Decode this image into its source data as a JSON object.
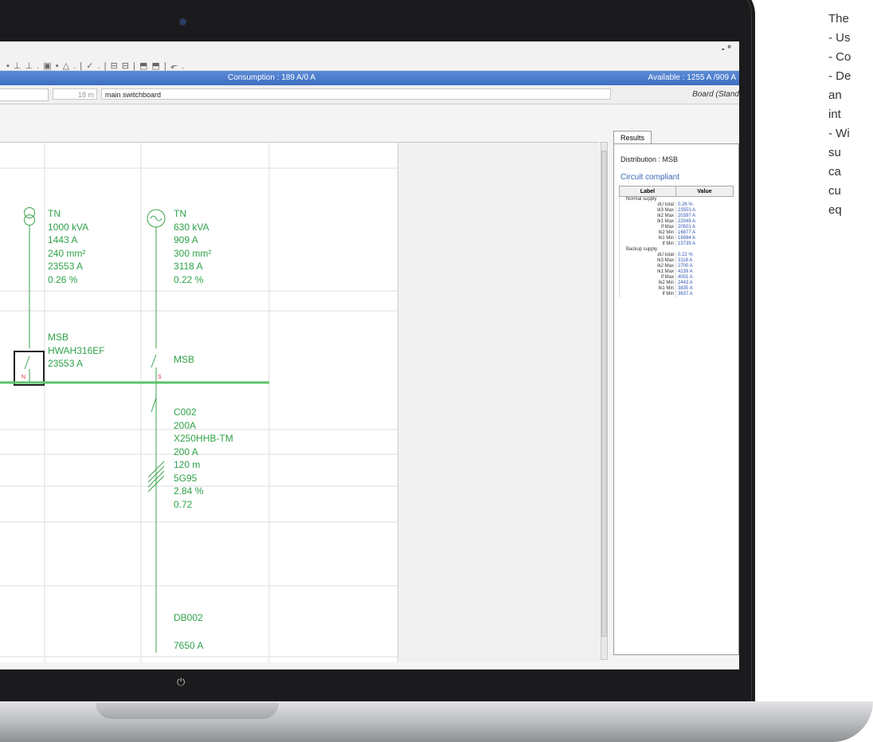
{
  "app": {
    "toolbar_icons": "• ⊥ ⊥ . ▣ • △ . | ✓ . | ⊟ ⊟ | ⬒ ⬒ | ⬐ .",
    "window_control": "- °",
    "consumption": "Consumption : 189 A/0 A",
    "available": "Available : 1255 A /909 A",
    "length_field": "18 m",
    "board_name": "main switchboard",
    "board_type": "Board (Stand"
  },
  "diagram": {
    "supply1": [
      "TN",
      "1000 kVA",
      "1443 A",
      "240 mm²",
      "23553 A",
      "0.26 %"
    ],
    "supply2": [
      "TN",
      "630 kVA",
      "909 A",
      "300 mm²",
      "3118 A",
      "0.22 %"
    ],
    "breaker1": [
      "MSB",
      "HWAH316EF",
      "23553 A"
    ],
    "breaker2": [
      "MSB"
    ],
    "marker_n": "N",
    "marker_s": "S",
    "circuit": [
      "C002",
      "200A",
      "X250HHB-TM",
      "200 A",
      "120 m",
      "5G95",
      "2.84 %",
      "0.72"
    ],
    "db_name": "DB002",
    "db_current": "7650 A"
  },
  "results": {
    "tab": "Results",
    "distribution": "Distribution : MSB",
    "compliant": "Circuit compliant",
    "col_label": "Label",
    "col_value": "Value",
    "group1": "Normal supply",
    "group2": "Backup supply",
    "rows1": [
      {
        "label": "dU total",
        "value": "0.26 %"
      },
      {
        "label": "Ik3 Max",
        "value": "23553 A"
      },
      {
        "label": "Ik2 Max",
        "value": "20397 A"
      },
      {
        "label": "Ik1 Max",
        "value": "22049 A"
      },
      {
        "label": "If Max",
        "value": "20501 A"
      },
      {
        "label": "Ik2 Min",
        "value": "16877 A"
      },
      {
        "label": "Ik1 Min",
        "value": "16994 A"
      },
      {
        "label": "If Min",
        "value": "15739 A"
      }
    ],
    "rows2": [
      {
        "label": "dU total",
        "value": "0.22 %"
      },
      {
        "label": "Ik3 Max",
        "value": "3118 A"
      },
      {
        "label": "Ik2 Max",
        "value": "2700 A"
      },
      {
        "label": "Ik1 Max",
        "value": "4239 A"
      },
      {
        "label": "If Max",
        "value": "4001 A"
      },
      {
        "label": "Ik2 Min",
        "value": "2443 A"
      },
      {
        "label": "Ik1 Min",
        "value": "3835 A"
      },
      {
        "label": "If Min",
        "value": "3637 A"
      }
    ]
  },
  "sidebar_text": [
    "The",
    "- Us",
    "- Co",
    "- De",
    "  an",
    "  int",
    "- Wi",
    "  su",
    "  ca",
    "  cu",
    "  eq"
  ]
}
